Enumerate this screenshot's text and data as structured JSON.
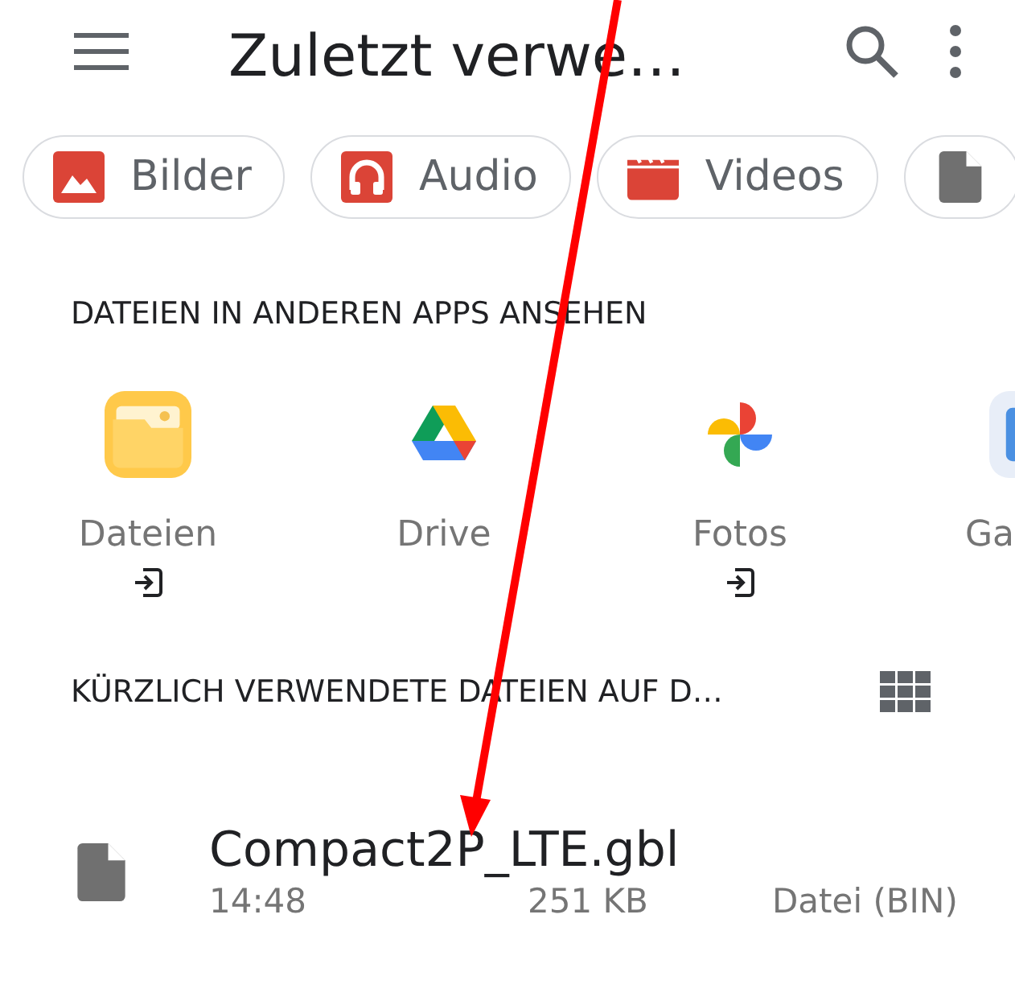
{
  "app_bar": {
    "title": "Zuletzt verwe…"
  },
  "chips": [
    {
      "kind": "images",
      "label": "Bilder"
    },
    {
      "kind": "audio",
      "label": "Audio"
    },
    {
      "kind": "videos",
      "label": "Videos"
    },
    {
      "kind": "documents"
    }
  ],
  "other_apps": {
    "heading": "DATEIEN IN ANDEREN APPS ANSEHEN",
    "apps": [
      {
        "kind": "files",
        "label": "Dateien",
        "external": true
      },
      {
        "kind": "drive",
        "label": "Drive",
        "external": false
      },
      {
        "kind": "photos",
        "label": "Fotos",
        "external": true
      },
      {
        "kind": "gallery",
        "label": "Ga",
        "external": false
      }
    ]
  },
  "recent": {
    "heading": "KÜRZLICH VERWENDETE DATEIEN AUF D…",
    "files": [
      {
        "name": "Compact2P_LTE.gbl",
        "time": "14:48",
        "size": "251 KB",
        "type": "Datei (BIN)"
      }
    ]
  }
}
